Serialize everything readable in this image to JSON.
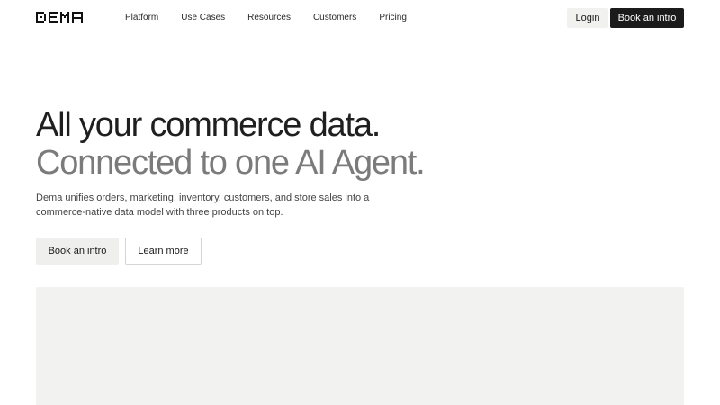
{
  "brand": {
    "logo_text": "DEMA",
    "logo_icon": "dema-wordmark"
  },
  "nav": {
    "items": [
      {
        "label": "Platform"
      },
      {
        "label": "Use Cases"
      },
      {
        "label": "Resources"
      },
      {
        "label": "Customers"
      },
      {
        "label": "Pricing"
      }
    ]
  },
  "header_actions": {
    "login_label": "Login",
    "book_label": "Book an intro"
  },
  "hero": {
    "headline_line1": "All your commerce data.",
    "headline_line2": "Connected to one AI Agent.",
    "description": "Dema unifies orders, marketing, inventory, customers, and store sales into a commerce-native data model with three products on top.",
    "primary_cta": "Book an intro",
    "secondary_cta": "Learn more"
  },
  "colors": {
    "text_primary": "#1f1f1f",
    "text_muted": "#7b7b7b",
    "button_dark": "#1b1b1b",
    "button_light": "#efefed",
    "panel_bg": "#f2f2f0"
  }
}
